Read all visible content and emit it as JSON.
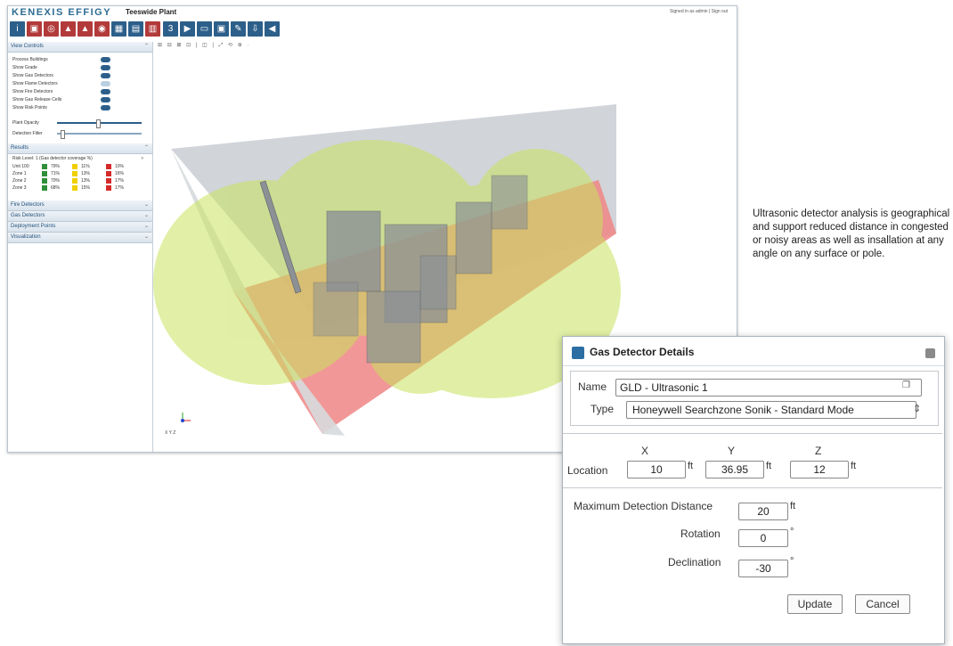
{
  "app": {
    "brand": "KENEXIS EFFIGY",
    "project_title": "Teeswide Plant",
    "user_info": "Signed in as admin | Sign out"
  },
  "view_controls": {
    "header": "View Controls",
    "toggles": [
      {
        "label": "Process Buildings",
        "on": true
      },
      {
        "label": "Show Grade",
        "on": true
      },
      {
        "label": "Show Gas Detectors",
        "on": true
      },
      {
        "label": "Show Flame Detectors",
        "on": false
      },
      {
        "label": "Show Fire Detectors",
        "on": true
      },
      {
        "label": "Show Gas Release Cells",
        "on": true
      },
      {
        "label": "Show Risk Points",
        "on": true
      }
    ],
    "sliders": [
      {
        "label": "Plant Opacity",
        "value": 0.48
      },
      {
        "label": "Detection Filter",
        "value": 0.04
      }
    ]
  },
  "results": {
    "header": "Results",
    "dropdown": "Risk Level: 1 (Gas detector coverage %)",
    "rows": [
      {
        "name": "Unit 100",
        "g": "79%",
        "y": "11%",
        "r": "10%"
      },
      {
        "name": "Zone 1",
        "g": "71%",
        "y": "13%",
        "r": "16%"
      },
      {
        "name": "Zone 2",
        "g": "70%",
        "y": "13%",
        "r": "17%"
      },
      {
        "name": "Zone 3",
        "g": "68%",
        "y": "15%",
        "r": "17%"
      }
    ]
  },
  "panels": [
    "Fire Detectors",
    "Gas Detectors",
    "Deployment Points",
    "Visualization"
  ],
  "viewport": {
    "toolbar_glyphs": "⊞ ⊟ ⊠ ⊡ | ◫ | ⤢ ⟲ ⊕ ·",
    "axis_label": "X Y Z"
  },
  "caption": "Ultrasonic detector analysis is geographical and support reduced distance in congested or noisy areas as well as insallation at any angle on any surface or pole.",
  "dialog": {
    "title": "Gas Detector Details",
    "name_label": "Name",
    "name_value": "GLD - Ultrasonic 1",
    "type_label": "Type",
    "type_value": "Honeywell Searchzone Sonik - Standard Mode",
    "location_label": "Location",
    "x_label": "X",
    "y_label": "Y",
    "z_label": "Z",
    "x_value": "10",
    "y_value": "36.95",
    "z_value": "12",
    "unit_ft": "ft",
    "max_dist_label": "Maximum Detection Distance",
    "max_dist_value": "20",
    "rotation_label": "Rotation",
    "rotation_value": "0",
    "declination_label": "Declination",
    "declination_value": "-30",
    "deg": "°",
    "update_label": "Update",
    "cancel_label": "Cancel"
  },
  "colors": {
    "accent": "#2c5f8a",
    "coverage": "#c8e35c",
    "uncovered": "#f08585",
    "wall": "#c9cdd2"
  }
}
